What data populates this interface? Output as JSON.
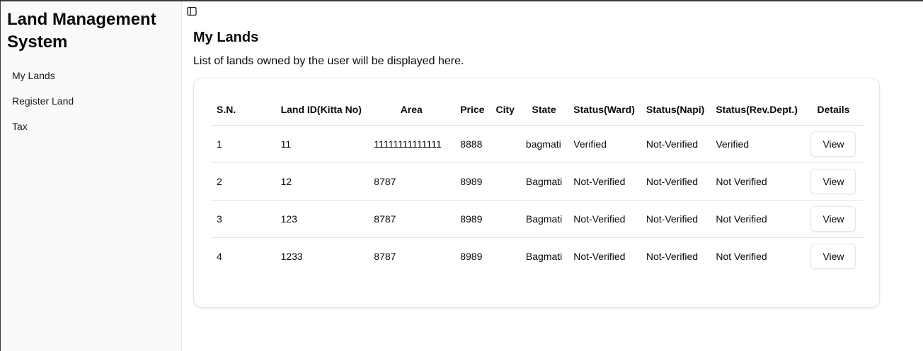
{
  "sidebar": {
    "title": "Land Management System",
    "items": [
      {
        "label": "My Lands"
      },
      {
        "label": "Register Land"
      },
      {
        "label": "Tax"
      }
    ]
  },
  "toggle_icon": "sidebar-toggle-icon",
  "main": {
    "title": "My Lands",
    "description": "List of lands owned by the user will be displayed here."
  },
  "table": {
    "headers": [
      "S.N.",
      "Land ID(Kitta No)",
      "Area",
      "Price",
      "City",
      "State",
      "Status(Ward)",
      "Status(Napi)",
      "Status(Rev.Dept.)",
      "Details"
    ],
    "rows": [
      {
        "sn": "1",
        "land_id": "11",
        "area": "11111111111111",
        "price": "8888",
        "city": "",
        "state": "bagmati",
        "status_ward": "Verified",
        "status_napi": "Not-Verified",
        "status_rev": "Verified",
        "action": "View"
      },
      {
        "sn": "2",
        "land_id": "12",
        "area": "8787",
        "price": "8989",
        "city": "",
        "state": "Bagmati",
        "status_ward": "Not-Verified",
        "status_napi": "Not-Verified",
        "status_rev": "Not Verified",
        "action": "View"
      },
      {
        "sn": "3",
        "land_id": "123",
        "area": "8787",
        "price": "8989",
        "city": "",
        "state": "Bagmati",
        "status_ward": "Not-Verified",
        "status_napi": "Not-Verified",
        "status_rev": "Not Verified",
        "action": "View"
      },
      {
        "sn": "4",
        "land_id": "1233",
        "area": "8787",
        "price": "8989",
        "city": "",
        "state": "Bagmati",
        "status_ward": "Not-Verified",
        "status_napi": "Not-Verified",
        "status_rev": "Not Verified",
        "action": "View"
      }
    ]
  }
}
